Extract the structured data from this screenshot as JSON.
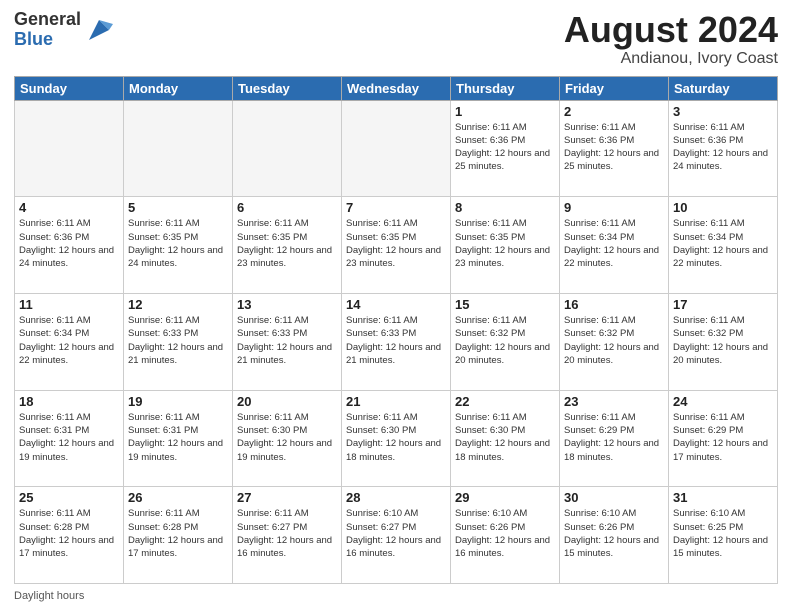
{
  "logo": {
    "general": "General",
    "blue": "Blue"
  },
  "title": "August 2024",
  "subtitle": "Andianou, Ivory Coast",
  "days_of_week": [
    "Sunday",
    "Monday",
    "Tuesday",
    "Wednesday",
    "Thursday",
    "Friday",
    "Saturday"
  ],
  "weeks": [
    [
      {
        "day": "",
        "empty": true
      },
      {
        "day": "",
        "empty": true
      },
      {
        "day": "",
        "empty": true
      },
      {
        "day": "",
        "empty": true
      },
      {
        "day": "1",
        "sunrise": "Sunrise: 6:11 AM",
        "sunset": "Sunset: 6:36 PM",
        "daylight": "Daylight: 12 hours and 25 minutes."
      },
      {
        "day": "2",
        "sunrise": "Sunrise: 6:11 AM",
        "sunset": "Sunset: 6:36 PM",
        "daylight": "Daylight: 12 hours and 25 minutes."
      },
      {
        "day": "3",
        "sunrise": "Sunrise: 6:11 AM",
        "sunset": "Sunset: 6:36 PM",
        "daylight": "Daylight: 12 hours and 24 minutes."
      }
    ],
    [
      {
        "day": "4",
        "sunrise": "Sunrise: 6:11 AM",
        "sunset": "Sunset: 6:36 PM",
        "daylight": "Daylight: 12 hours and 24 minutes."
      },
      {
        "day": "5",
        "sunrise": "Sunrise: 6:11 AM",
        "sunset": "Sunset: 6:35 PM",
        "daylight": "Daylight: 12 hours and 24 minutes."
      },
      {
        "day": "6",
        "sunrise": "Sunrise: 6:11 AM",
        "sunset": "Sunset: 6:35 PM",
        "daylight": "Daylight: 12 hours and 23 minutes."
      },
      {
        "day": "7",
        "sunrise": "Sunrise: 6:11 AM",
        "sunset": "Sunset: 6:35 PM",
        "daylight": "Daylight: 12 hours and 23 minutes."
      },
      {
        "day": "8",
        "sunrise": "Sunrise: 6:11 AM",
        "sunset": "Sunset: 6:35 PM",
        "daylight": "Daylight: 12 hours and 23 minutes."
      },
      {
        "day": "9",
        "sunrise": "Sunrise: 6:11 AM",
        "sunset": "Sunset: 6:34 PM",
        "daylight": "Daylight: 12 hours and 22 minutes."
      },
      {
        "day": "10",
        "sunrise": "Sunrise: 6:11 AM",
        "sunset": "Sunset: 6:34 PM",
        "daylight": "Daylight: 12 hours and 22 minutes."
      }
    ],
    [
      {
        "day": "11",
        "sunrise": "Sunrise: 6:11 AM",
        "sunset": "Sunset: 6:34 PM",
        "daylight": "Daylight: 12 hours and 22 minutes."
      },
      {
        "day": "12",
        "sunrise": "Sunrise: 6:11 AM",
        "sunset": "Sunset: 6:33 PM",
        "daylight": "Daylight: 12 hours and 21 minutes."
      },
      {
        "day": "13",
        "sunrise": "Sunrise: 6:11 AM",
        "sunset": "Sunset: 6:33 PM",
        "daylight": "Daylight: 12 hours and 21 minutes."
      },
      {
        "day": "14",
        "sunrise": "Sunrise: 6:11 AM",
        "sunset": "Sunset: 6:33 PM",
        "daylight": "Daylight: 12 hours and 21 minutes."
      },
      {
        "day": "15",
        "sunrise": "Sunrise: 6:11 AM",
        "sunset": "Sunset: 6:32 PM",
        "daylight": "Daylight: 12 hours and 20 minutes."
      },
      {
        "day": "16",
        "sunrise": "Sunrise: 6:11 AM",
        "sunset": "Sunset: 6:32 PM",
        "daylight": "Daylight: 12 hours and 20 minutes."
      },
      {
        "day": "17",
        "sunrise": "Sunrise: 6:11 AM",
        "sunset": "Sunset: 6:32 PM",
        "daylight": "Daylight: 12 hours and 20 minutes."
      }
    ],
    [
      {
        "day": "18",
        "sunrise": "Sunrise: 6:11 AM",
        "sunset": "Sunset: 6:31 PM",
        "daylight": "Daylight: 12 hours and 19 minutes."
      },
      {
        "day": "19",
        "sunrise": "Sunrise: 6:11 AM",
        "sunset": "Sunset: 6:31 PM",
        "daylight": "Daylight: 12 hours and 19 minutes."
      },
      {
        "day": "20",
        "sunrise": "Sunrise: 6:11 AM",
        "sunset": "Sunset: 6:30 PM",
        "daylight": "Daylight: 12 hours and 19 minutes."
      },
      {
        "day": "21",
        "sunrise": "Sunrise: 6:11 AM",
        "sunset": "Sunset: 6:30 PM",
        "daylight": "Daylight: 12 hours and 18 minutes."
      },
      {
        "day": "22",
        "sunrise": "Sunrise: 6:11 AM",
        "sunset": "Sunset: 6:30 PM",
        "daylight": "Daylight: 12 hours and 18 minutes."
      },
      {
        "day": "23",
        "sunrise": "Sunrise: 6:11 AM",
        "sunset": "Sunset: 6:29 PM",
        "daylight": "Daylight: 12 hours and 18 minutes."
      },
      {
        "day": "24",
        "sunrise": "Sunrise: 6:11 AM",
        "sunset": "Sunset: 6:29 PM",
        "daylight": "Daylight: 12 hours and 17 minutes."
      }
    ],
    [
      {
        "day": "25",
        "sunrise": "Sunrise: 6:11 AM",
        "sunset": "Sunset: 6:28 PM",
        "daylight": "Daylight: 12 hours and 17 minutes."
      },
      {
        "day": "26",
        "sunrise": "Sunrise: 6:11 AM",
        "sunset": "Sunset: 6:28 PM",
        "daylight": "Daylight: 12 hours and 17 minutes."
      },
      {
        "day": "27",
        "sunrise": "Sunrise: 6:11 AM",
        "sunset": "Sunset: 6:27 PM",
        "daylight": "Daylight: 12 hours and 16 minutes."
      },
      {
        "day": "28",
        "sunrise": "Sunrise: 6:10 AM",
        "sunset": "Sunset: 6:27 PM",
        "daylight": "Daylight: 12 hours and 16 minutes."
      },
      {
        "day": "29",
        "sunrise": "Sunrise: 6:10 AM",
        "sunset": "Sunset: 6:26 PM",
        "daylight": "Daylight: 12 hours and 16 minutes."
      },
      {
        "day": "30",
        "sunrise": "Sunrise: 6:10 AM",
        "sunset": "Sunset: 6:26 PM",
        "daylight": "Daylight: 12 hours and 15 minutes."
      },
      {
        "day": "31",
        "sunrise": "Sunrise: 6:10 AM",
        "sunset": "Sunset: 6:25 PM",
        "daylight": "Daylight: 12 hours and 15 minutes."
      }
    ]
  ],
  "footer": {
    "daylight_label": "Daylight hours"
  }
}
